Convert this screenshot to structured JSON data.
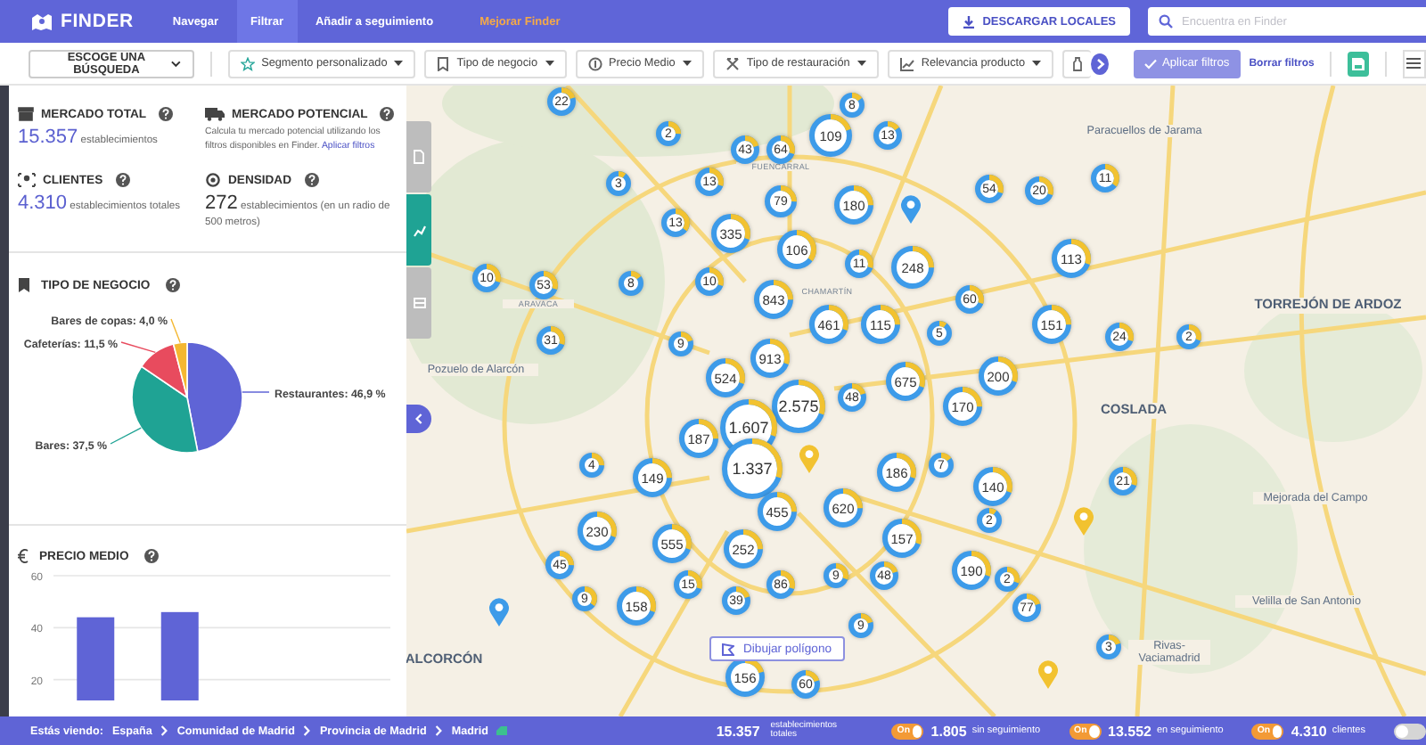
{
  "header": {
    "logo": "FINDER",
    "nav": [
      {
        "label": "Navegar",
        "selected": false,
        "kind": "link"
      },
      {
        "label": "Filtrar",
        "selected": true,
        "kind": "link"
      },
      {
        "label": "Añadir a seguimiento",
        "selected": false,
        "kind": "link"
      },
      {
        "label": "Mejorar Finder",
        "selected": false,
        "kind": "upgrade"
      }
    ],
    "download_button": "DESCARGAR LOCALES",
    "search": {
      "placeholder": "Encuentra en Finder"
    }
  },
  "filters": {
    "search_select": "ESCOGE UNA BÚSQUEDA",
    "dropdowns": [
      {
        "kind": "full",
        "label": "Segmento personalizado"
      },
      {
        "kind": "full",
        "label": "Tipo de negocio"
      },
      {
        "kind": "full",
        "label": "Precio Medio"
      },
      {
        "kind": "full",
        "label": "Tipo de restauración"
      },
      {
        "kind": "full",
        "label": "Relevancia producto"
      },
      {
        "kind": "cut"
      }
    ],
    "apply_button": "Aplicar filtros",
    "clear_link": "Borrar filtros"
  },
  "stats": [
    {
      "kind": "metric",
      "title": "MERCADO TOTAL",
      "value": "15.357",
      "caption": "establecimientos",
      "highlight": true
    },
    {
      "kind": "note",
      "title": "MERCADO POTENCIAL",
      "text": "Calcula tu mercado potencial utilizando los filtros disponibles en Finder.",
      "link": "Aplicar filtros"
    },
    {
      "kind": "metric",
      "title": "CLIENTES",
      "value": "4.310",
      "caption": "establecimientos totales",
      "highlight": true
    },
    {
      "kind": "metric",
      "title": "DENSIDAD",
      "value": "272",
      "caption": "establecimientos (en un radio de 500 metros)",
      "highlight": false
    }
  ],
  "business_type": {
    "title": "TIPO DE NEGOCIO",
    "chart_data": {
      "type": "pie",
      "categories": [
        "Restaurantes",
        "Bares",
        "Cafeterías",
        "Bares de copas"
      ],
      "values": [
        46.9,
        37.5,
        11.5,
        4.0
      ],
      "value_labels": [
        "46,9 %",
        "37,5 %",
        "11,5 %",
        "4,0 %"
      ]
    }
  },
  "average_price": {
    "title": "PRECIO MEDIO",
    "chart_data": {
      "type": "bar",
      "values": [
        44,
        46,
        null,
        null
      ],
      "ylim": [
        12,
        60
      ],
      "yticks": [
        20,
        40,
        60
      ]
    }
  },
  "map": {
    "side_tabs": [
      {
        "selected": false
      },
      {
        "selected": true
      },
      {
        "selected": false
      }
    ],
    "places": [
      {
        "name": "Paracuellos de Jarama",
        "kind": "town"
      },
      {
        "name": "TORREJÓN DE ARDOZ",
        "kind": "city"
      },
      {
        "name": "COSLADA",
        "kind": "city"
      },
      {
        "name": "Mejorada del Campo",
        "kind": "town"
      },
      {
        "name": "Velilla de San Antonio",
        "kind": "town"
      },
      {
        "name": "Rivas-Vaciamadrid",
        "kind": "town"
      },
      {
        "name": "Pozuelo de Alarcón",
        "kind": "town"
      },
      {
        "name": "ALCORCÓN",
        "kind": "city"
      },
      {
        "name": "FUENCARRAL",
        "kind": "district"
      },
      {
        "name": "CHAMARTÍN",
        "kind": "district"
      },
      {
        "name": "ARAVACA",
        "kind": "district"
      }
    ],
    "clusters": [
      {
        "count": "22",
        "level": 0.2
      },
      {
        "count": "2",
        "level": 0.25
      },
      {
        "count": "8",
        "level": 0.15
      },
      {
        "count": "109",
        "level": 0.2
      },
      {
        "count": "13",
        "level": 0.15
      },
      {
        "count": "43",
        "level": 0.2
      },
      {
        "count": "64",
        "level": 0.3
      },
      {
        "count": "3",
        "level": 0.1
      },
      {
        "count": "13",
        "level": 0.3
      },
      {
        "count": "79",
        "level": 0.25
      },
      {
        "count": "180",
        "level": 0.25
      },
      {
        "count": "54",
        "level": 0.3
      },
      {
        "count": "20",
        "level": 0.3
      },
      {
        "count": "11",
        "level": 0.35
      },
      {
        "count": "13",
        "level": 0.35
      },
      {
        "count": "335",
        "level": 0.3
      },
      {
        "count": "106",
        "level": 0.35
      },
      {
        "count": "11",
        "level": 0.3
      },
      {
        "count": "248",
        "level": 0.25
      },
      {
        "count": "113",
        "level": 0.3
      },
      {
        "count": "10",
        "level": 0.3
      },
      {
        "count": "53",
        "level": 0.3
      },
      {
        "count": "8",
        "level": 0.15
      },
      {
        "count": "10",
        "level": 0.3
      },
      {
        "count": "843",
        "level": 0.25
      },
      {
        "count": "60",
        "level": 0.3
      },
      {
        "count": "461",
        "level": 0.3
      },
      {
        "count": "115",
        "level": 0.25
      },
      {
        "count": "5",
        "level": 0.1
      },
      {
        "count": "151",
        "level": 0.25
      },
      {
        "count": "24",
        "level": 0.3
      },
      {
        "count": "2",
        "level": 0.3
      },
      {
        "count": "31",
        "level": 0.3
      },
      {
        "count": "9",
        "level": 0.2
      },
      {
        "count": "913",
        "level": 0.3
      },
      {
        "count": "524",
        "level": 0.3
      },
      {
        "count": "675",
        "level": 0.3
      },
      {
        "count": "200",
        "level": 0.3
      },
      {
        "count": "2.575",
        "level": 0.3
      },
      {
        "count": "48",
        "level": 0.2
      },
      {
        "count": "170",
        "level": 0.25
      },
      {
        "count": "187",
        "level": 0.25
      },
      {
        "count": "4",
        "level": 0.25
      },
      {
        "count": "1.607",
        "level": 0.3
      },
      {
        "count": "1.337",
        "level": 0.3
      },
      {
        "count": "149",
        "level": 0.25
      },
      {
        "count": "186",
        "level": 0.3
      },
      {
        "count": "7",
        "level": 0.15
      },
      {
        "count": "140",
        "level": 0.3
      },
      {
        "count": "21",
        "level": 0.3
      },
      {
        "count": "455",
        "level": 0.25
      },
      {
        "count": "620",
        "level": 0.25
      },
      {
        "count": "2",
        "level": 0.1
      },
      {
        "count": "230",
        "level": 0.3
      },
      {
        "count": "555",
        "level": 0.3
      },
      {
        "count": "252",
        "level": 0.25
      },
      {
        "count": "157",
        "level": 0.3
      },
      {
        "count": "45",
        "level": 0.25
      },
      {
        "count": "15",
        "level": 0.3
      },
      {
        "count": "86",
        "level": 0.3
      },
      {
        "count": "9",
        "level": 0.3
      },
      {
        "count": "48",
        "level": 0.2
      },
      {
        "count": "190",
        "level": 0.3
      },
      {
        "count": "2",
        "level": 0.3
      },
      {
        "count": "9",
        "level": 0.35
      },
      {
        "count": "158",
        "level": 0.3
      },
      {
        "count": "39",
        "level": 0.2
      },
      {
        "count": "77",
        "level": 0.2
      },
      {
        "count": "9",
        "level": 0.2
      },
      {
        "count": "3",
        "level": 0.2
      },
      {
        "count": "156",
        "level": 0.2
      },
      {
        "count": "60",
        "level": 0.2
      }
    ],
    "pins": [
      {
        "color": "#3d9be9"
      },
      {
        "color": "#f2c230"
      },
      {
        "color": "#f2c230"
      },
      {
        "color": "#3d9be9"
      },
      {
        "color": "#f2c230"
      }
    ],
    "draw_button": "Dibujar polígono"
  },
  "bottom_bar": {
    "prefix": "Estás viendo:",
    "breadcrumbs": [
      "España",
      "Comunidad de Madrid",
      "Provincia de Madrid",
      "Madrid"
    ],
    "total": {
      "value": "15.357",
      "caption": "establecimientos totales"
    },
    "toggles": [
      {
        "on": true,
        "label": "On",
        "value": "1.805",
        "caption": "sin seguimiento"
      },
      {
        "on": true,
        "label": "On",
        "value": "13.552",
        "caption": "en seguimiento"
      },
      {
        "on": true,
        "label": "On",
        "value": "4.310",
        "caption": "clientes"
      },
      {
        "on": false
      }
    ]
  }
}
